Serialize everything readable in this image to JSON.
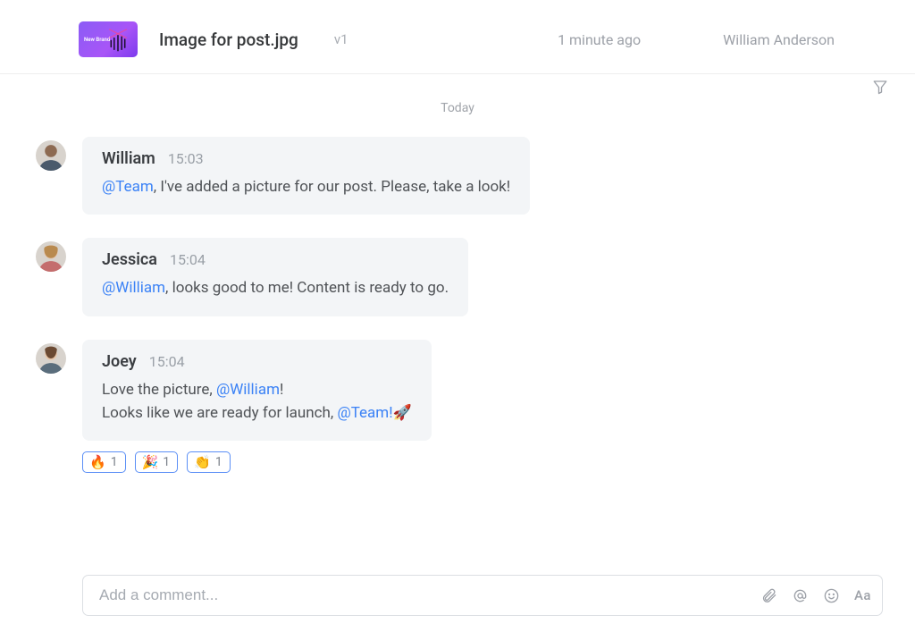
{
  "header": {
    "thumb_caption": "New\nBrand",
    "filename": "Image for post.jpg",
    "version": "v1",
    "time_ago": "1 minute ago",
    "uploader": "William Anderson"
  },
  "date_separator": "Today",
  "messages": [
    {
      "author": "William",
      "time": "15:03",
      "segments": [
        {
          "type": "mention",
          "text": "@Team"
        },
        {
          "type": "text",
          "text": ", I've added a picture for our post. Please, take a look!"
        }
      ]
    },
    {
      "author": "Jessica",
      "time": "15:04",
      "segments": [
        {
          "type": "mention",
          "text": "@William"
        },
        {
          "type": "text",
          "text": ", looks good to me! Content is ready to go."
        }
      ]
    },
    {
      "author": "Joey",
      "time": "15:04",
      "segments": [
        {
          "type": "text",
          "text": "Love the picture, "
        },
        {
          "type": "mention",
          "text": "@William"
        },
        {
          "type": "text",
          "text": "!"
        },
        {
          "type": "br"
        },
        {
          "type": "text",
          "text": "Looks like we are ready for launch, "
        },
        {
          "type": "mention",
          "text": "@Team!"
        },
        {
          "type": "text",
          "text": "🚀"
        }
      ],
      "reactions": [
        {
          "emoji": "🔥",
          "count": "1"
        },
        {
          "emoji": "🎉",
          "count": "1"
        },
        {
          "emoji": "👏",
          "count": "1"
        }
      ]
    }
  ],
  "composer": {
    "placeholder": "Add a comment..."
  },
  "icons": {
    "filter": "filter-icon",
    "attach": "paperclip-icon",
    "mention": "at-icon",
    "emoji": "smiley-icon",
    "format": "Aa"
  }
}
